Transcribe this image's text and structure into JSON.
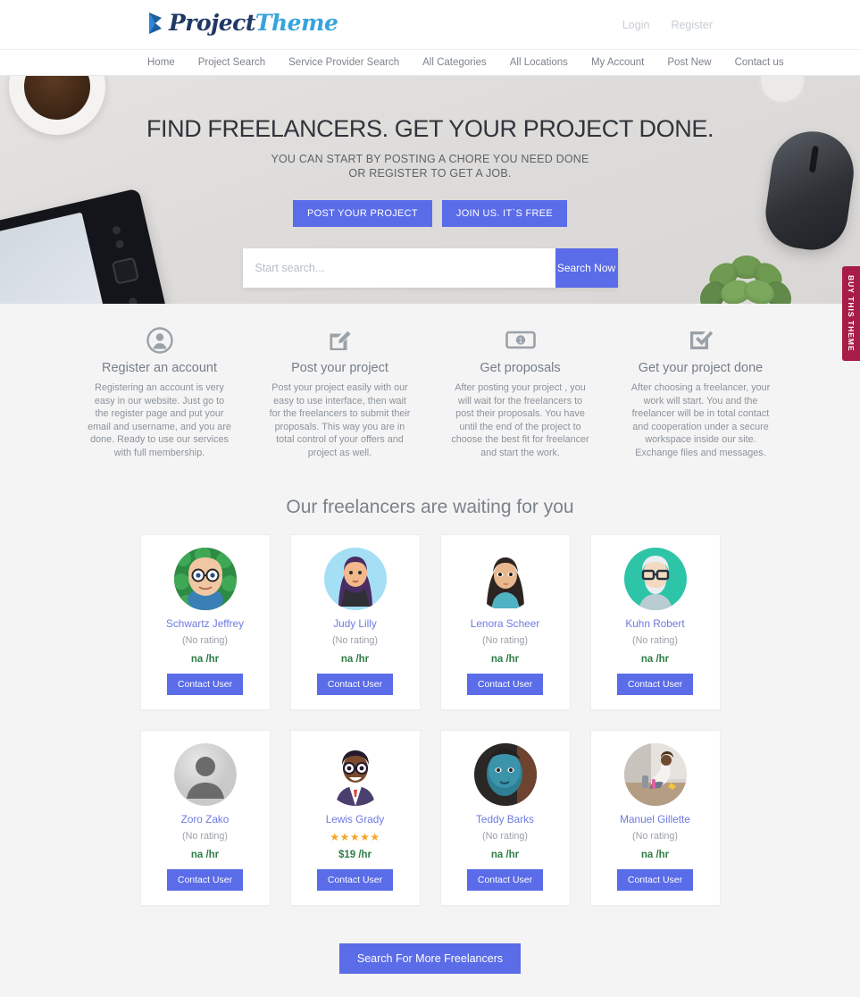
{
  "header": {
    "logo_primary": "Project",
    "logo_secondary": "Theme",
    "login_label": "Login",
    "register_label": "Register"
  },
  "nav": {
    "items": [
      {
        "label": "Home"
      },
      {
        "label": "Project Search"
      },
      {
        "label": "Service Provider Search"
      },
      {
        "label": "All Categories"
      },
      {
        "label": "All Locations"
      },
      {
        "label": "My Account"
      },
      {
        "label": "Post New"
      },
      {
        "label": "Contact us"
      }
    ]
  },
  "hero": {
    "title": "FIND FREELANCERS. GET YOUR PROJECT DONE.",
    "subtitle_line1": "YOU CAN START BY POSTING A CHORE YOU NEED DONE",
    "subtitle_line2": "OR REGISTER TO GET A JOB.",
    "cta_post": "POST YOUR PROJECT",
    "cta_join": "JOIN US. IT`S FREE",
    "search_placeholder": "Start search...",
    "search_value": "",
    "search_button": "Search Now"
  },
  "features": [
    {
      "icon": "user-circle-icon",
      "title": "Register an account",
      "text": "Registering an account is very easy in our website. Just go to the register page and put your email and username, and you are done. Ready to use our services with full membership."
    },
    {
      "icon": "edit-pencil-icon",
      "title": "Post your project",
      "text": "Post your project easily with our easy to use interface, then wait for the freelancers to submit their proposals. This way you are in total control of your offers and project as well."
    },
    {
      "icon": "banknote-icon",
      "title": "Get proposals",
      "text": "After posting your project , you will wait for the freelancers to post their proposals. You have until the end of the project to choose the best fit for freelancer and start the work."
    },
    {
      "icon": "check-box-icon",
      "title": "Get your project done",
      "text": "After choosing a freelancer, your work will start. You and the freelancer will be in total contact and cooperation under a secure workspace inside our site. Exchange files and messages."
    }
  ],
  "freelancers_section": {
    "heading": "Our freelancers are waiting for you",
    "contact_label": "Contact User",
    "more_button": "Search For More Freelancers",
    "cards": [
      {
        "name": "Schwartz Jeffrey",
        "rating": "(No rating)",
        "stars": 0,
        "rate": "na /hr",
        "avatar": "bald-man-glasses-green-bg"
      },
      {
        "name": "Judy Lilly",
        "rating": "(No rating)",
        "stars": 0,
        "rate": "na /hr",
        "avatar": "woman-purple-hair-blue-bg"
      },
      {
        "name": "Lenora Scheer",
        "rating": "(No rating)",
        "stars": 0,
        "rate": "na /hr",
        "avatar": "woman-dark-hair-teal-top"
      },
      {
        "name": "Kuhn Robert",
        "rating": "(No rating)",
        "stars": 0,
        "rate": "na /hr",
        "avatar": "older-man-glasses-teal-bg"
      },
      {
        "name": "Zoro Zako",
        "rating": "(No rating)",
        "stars": 0,
        "rate": "na /hr",
        "avatar": "default-silhouette"
      },
      {
        "name": "Lewis Grady",
        "rating": "",
        "stars": 5,
        "rate": "$19 /hr",
        "avatar": "man-glasses-suit-tie"
      },
      {
        "name": "Teddy Barks",
        "rating": "(No rating)",
        "stars": 0,
        "rate": "na /hr",
        "avatar": "blue-face-portrait-photo"
      },
      {
        "name": "Manuel Gillette",
        "rating": "(No rating)",
        "stars": 0,
        "rate": "na /hr",
        "avatar": "woman-cleaning-photo"
      }
    ]
  },
  "side_tab": {
    "label": "BUY THIS THEME"
  },
  "colors": {
    "accent": "#5a6ce8",
    "link": "#6d7ae0",
    "rate_green": "#2e7d46",
    "star_gold": "#f5a623",
    "buy_tab": "#a81d48",
    "logo_dark": "#1f3864",
    "logo_light": "#35a4dd"
  }
}
